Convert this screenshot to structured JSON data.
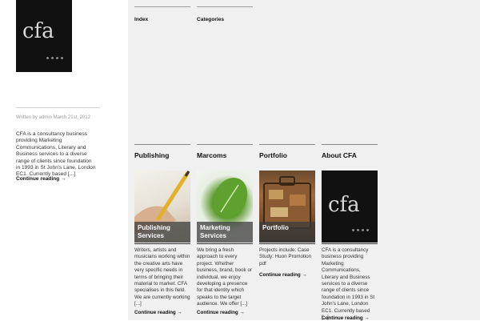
{
  "brand": {
    "logo_text": "cfa"
  },
  "nav": {
    "index_label": "Index",
    "categories_label": "Categories"
  },
  "post": {
    "meta": "Written by admin March 21st, 2012",
    "excerpt": "CFA is a consultancy business providing Marketing Communications, Literary and Business services to a diverse range of clients since foundation in 1993 in St John's Lane, London EC1. Currently based [...]",
    "continue_label": "Continue reading →"
  },
  "sections": [
    {
      "title": "Publishing",
      "image_label": "Publishing Services",
      "description": "Writers, artists and musicians working within the creative arts have very specific needs in terms of bringing their material to market. CFA specialises in this field. We are currently working [...]",
      "continue_label": "Continue reading →"
    },
    {
      "title": "Marcoms",
      "image_label": "Marketing Services",
      "description": "We bring a fresh approach to every project. Whether business, brand, book or individual, we enjoy developing a presence for that identity which speaks to the target audience. We offer [...]",
      "continue_label": "Continue reading →"
    },
    {
      "title": "Portfolio",
      "image_label": "Portfolio",
      "description": "Projects include: Case Study: Huon Promotion pdf",
      "continue_label": "Continue reading →"
    },
    {
      "title": "About CFA",
      "image_label": "cfa",
      "description": "CFA is a consultancy business providing Marketing Communications, Literary and Business services to a diverse range of clients since foundation in 1993 in St John's Lane, London EC1. Currently based [...]",
      "continue_label": "Continue reading →"
    }
  ],
  "colors": {
    "sidebar_bg": "#ffffff",
    "content_bg": "#f0f0f0",
    "logo_bg": "#111111",
    "text": "#222222"
  }
}
